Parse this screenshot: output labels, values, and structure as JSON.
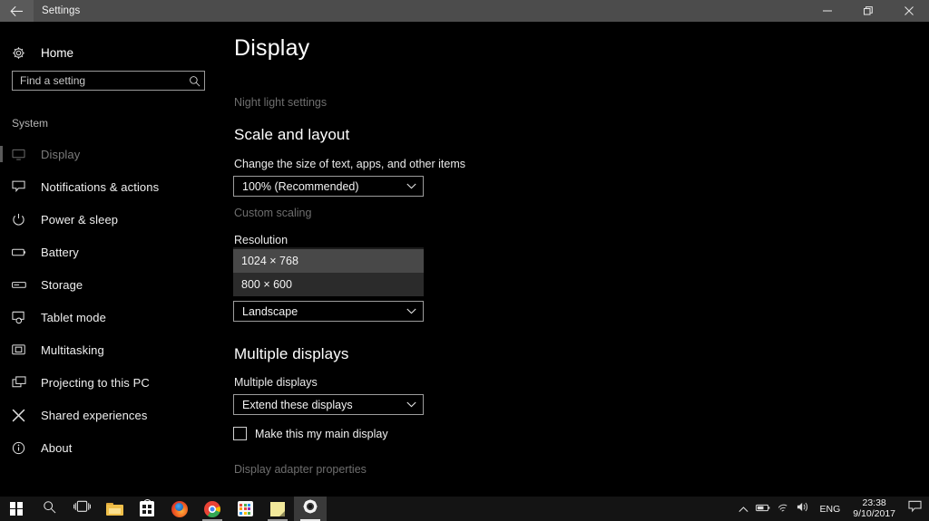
{
  "window": {
    "title": "Settings",
    "back_icon": "back-arrow-icon",
    "controls": {
      "minimize": "minimize-icon",
      "restore": "restore-icon",
      "close": "close-icon"
    }
  },
  "sidebar": {
    "home": {
      "label": "Home",
      "icon": "gear-icon"
    },
    "search": {
      "value": "",
      "placeholder": "Find a setting",
      "icon": "search-icon"
    },
    "group_label": "System",
    "items": [
      {
        "label": "Display",
        "icon": "monitor-icon",
        "selected": true,
        "dim": true
      },
      {
        "label": "Notifications & actions",
        "icon": "notification-bubble-icon",
        "selected": false,
        "dim": false
      },
      {
        "label": "Power & sleep",
        "icon": "power-icon",
        "selected": false,
        "dim": false
      },
      {
        "label": "Battery",
        "icon": "battery-icon",
        "selected": false,
        "dim": false
      },
      {
        "label": "Storage",
        "icon": "storage-drive-icon",
        "selected": false,
        "dim": false
      },
      {
        "label": "Tablet mode",
        "icon": "tablet-mode-icon",
        "selected": false,
        "dim": false
      },
      {
        "label": "Multitasking",
        "icon": "multitasking-icon",
        "selected": false,
        "dim": false
      },
      {
        "label": "Projecting to this PC",
        "icon": "projecting-icon",
        "selected": false,
        "dim": false
      },
      {
        "label": "Shared experiences",
        "icon": "shared-experiences-icon",
        "selected": false,
        "dim": false
      },
      {
        "label": "About",
        "icon": "info-circle-icon",
        "selected": false,
        "dim": false
      }
    ]
  },
  "main": {
    "page_title": "Display",
    "night_light_link": "Night light settings",
    "scale_section": {
      "heading": "Scale and layout",
      "size_label": "Change the size of text, apps, and other items",
      "scale_value": "100% (Recommended)",
      "custom_scaling_link": "Custom scaling",
      "resolution_label": "Resolution",
      "resolution_options": [
        {
          "label": "1024 × 768",
          "highlighted": true
        },
        {
          "label": "800 × 600",
          "highlighted": false
        }
      ],
      "orientation_value": "Landscape"
    },
    "multiple_section": {
      "heading": "Multiple displays",
      "field_label": "Multiple displays",
      "mode_value": "Extend these displays",
      "checkbox_label": "Make this my main display",
      "checkbox_checked": false
    },
    "adapter_link": "Display adapter properties"
  },
  "taskbar": {
    "buttons": [
      {
        "name": "start-button",
        "icon": "windows-logo-icon",
        "running": false,
        "active": false
      },
      {
        "name": "search-button",
        "icon": "search-icon",
        "running": false,
        "active": false
      },
      {
        "name": "task-view-button",
        "icon": "task-view-icon",
        "running": false,
        "active": false
      },
      {
        "name": "file-explorer-button",
        "icon": "folder-icon",
        "running": false,
        "active": false
      },
      {
        "name": "microsoft-store-button",
        "icon": "store-bag-icon",
        "running": false,
        "active": false
      },
      {
        "name": "firefox-button",
        "icon": "firefox-icon",
        "running": false,
        "active": false
      },
      {
        "name": "chrome-button",
        "icon": "chrome-icon",
        "running": true,
        "active": false
      },
      {
        "name": "calculator-button",
        "icon": "calculator-icon",
        "running": false,
        "active": false
      },
      {
        "name": "sticky-notes-button",
        "icon": "sticky-note-icon",
        "running": true,
        "active": false
      },
      {
        "name": "settings-button",
        "icon": "gear-icon",
        "running": true,
        "active": true
      }
    ],
    "tray": {
      "overflow_icon": "chevron-up-icon",
      "battery_icon": "battery-icon",
      "network_icon": "wifi-icon",
      "volume_icon": "speaker-icon",
      "language": "ENG",
      "time": "23:38",
      "date": "9/10/2017",
      "action_center_icon": "action-center-icon"
    }
  },
  "colors": {
    "window_background": "#000000",
    "titlebar": "#4c4c4c",
    "taskbar": "#141414",
    "dropdown_panel": "#2b2b2b",
    "dropdown_highlight": "#484848",
    "accent_text": "#ffffff",
    "disabled_text": "#6e6e6e"
  }
}
